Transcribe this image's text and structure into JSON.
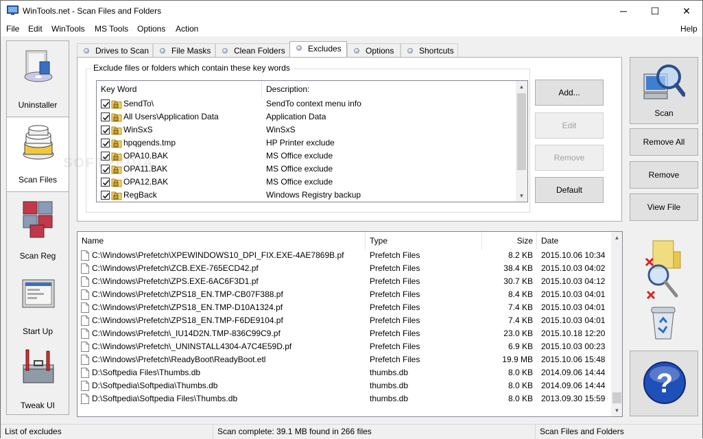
{
  "window": {
    "title": "WinTools.net - Scan Files and Folders",
    "minimize": "─",
    "maximize": "☐",
    "close": "✕"
  },
  "menu": {
    "file": "File",
    "edit": "Edit",
    "wintools": "WinTools",
    "mstools": "MS Tools",
    "options": "Options",
    "action": "Action",
    "help": "Help"
  },
  "sidebar": {
    "items": [
      {
        "label": "Uninstaller",
        "icon": "uninstaller-icon"
      },
      {
        "label": "Scan Files",
        "icon": "scan-files-icon",
        "active": true
      },
      {
        "label": "Scan Reg",
        "icon": "scan-reg-icon"
      },
      {
        "label": "Start Up",
        "icon": "startup-icon"
      },
      {
        "label": "Tweak UI",
        "icon": "tweak-ui-icon"
      }
    ]
  },
  "tabs": [
    {
      "label": "Drives to Scan"
    },
    {
      "label": "File Masks"
    },
    {
      "label": "Clean Folders"
    },
    {
      "label": "Excludes",
      "active": true
    },
    {
      "label": "Options"
    },
    {
      "label": "Shortcuts"
    }
  ],
  "excludes": {
    "group_title": "Exclude files or folders which contain these key words",
    "headers": {
      "keyword": "Key Word",
      "description": "Description:"
    },
    "rows": [
      {
        "keyword": "SendTo\\",
        "description": "SendTo context menu info",
        "checked": true
      },
      {
        "keyword": "All Users\\Application Data",
        "description": "Application Data",
        "checked": true
      },
      {
        "keyword": "WinSxS",
        "description": "WinSxS",
        "checked": true
      },
      {
        "keyword": "hpqgends.tmp",
        "description": "HP Printer exclude",
        "checked": true
      },
      {
        "keyword": "OPA10.BAK",
        "description": "MS Office exclude",
        "checked": true
      },
      {
        "keyword": "OPA11.BAK",
        "description": "MS Office exclude",
        "checked": true
      },
      {
        "keyword": "OPA12.BAK",
        "description": "MS Office exclude",
        "checked": true
      },
      {
        "keyword": "RegBack",
        "description": "Windows Registry backup",
        "checked": true
      }
    ],
    "buttons": {
      "add": "Add...",
      "edit": "Edit",
      "remove": "Remove",
      "default": "Default"
    }
  },
  "actions": {
    "scan": "Scan",
    "remove_all": "Remove All",
    "remove": "Remove",
    "view_file": "View File"
  },
  "files": {
    "headers": {
      "name": "Name",
      "type": "Type",
      "size": "Size",
      "date": "Date"
    },
    "rows": [
      {
        "name": "C:\\Windows\\Prefetch\\XPEWINDOWS10_DPI_FIX.EXE-4AE7869B.pf",
        "type": "Prefetch Files",
        "size": "8.2 KB",
        "date": "2015.10.06 10:34"
      },
      {
        "name": "C:\\Windows\\Prefetch\\ZCB.EXE-765ECD42.pf",
        "type": "Prefetch Files",
        "size": "38.4 KB",
        "date": "2015.10.03 04:02"
      },
      {
        "name": "C:\\Windows\\Prefetch\\ZPS.EXE-6AC6F3D1.pf",
        "type": "Prefetch Files",
        "size": "30.7 KB",
        "date": "2015.10.03 04:12"
      },
      {
        "name": "C:\\Windows\\Prefetch\\ZPS18_EN.TMP-CB07F388.pf",
        "type": "Prefetch Files",
        "size": "8.4 KB",
        "date": "2015.10.03 04:01"
      },
      {
        "name": "C:\\Windows\\Prefetch\\ZPS18_EN.TMP-D10A1324.pf",
        "type": "Prefetch Files",
        "size": "7.4 KB",
        "date": "2015.10.03 04:01"
      },
      {
        "name": "C:\\Windows\\Prefetch\\ZPS18_EN.TMP-F6DE9104.pf",
        "type": "Prefetch Files",
        "size": "7.4 KB",
        "date": "2015.10.03 04:01"
      },
      {
        "name": "C:\\Windows\\Prefetch\\_IU14D2N.TMP-836C99C9.pf",
        "type": "Prefetch Files",
        "size": "23.0 KB",
        "date": "2015.10.18 12:20"
      },
      {
        "name": "C:\\Windows\\Prefetch\\_UNINSTALL4304-A7C4E59D.pf",
        "type": "Prefetch Files",
        "size": "6.9 KB",
        "date": "2015.10.03 00:23"
      },
      {
        "name": "C:\\Windows\\Prefetch\\ReadyBoot\\ReadyBoot.etl",
        "type": "Prefetch Files",
        "size": "19.9 MB",
        "date": "2015.10.06 15:48"
      },
      {
        "name": "D:\\Softpedia Files\\Thumbs.db",
        "type": "thumbs.db",
        "size": "8.0 KB",
        "date": "2014.09.06 14:44"
      },
      {
        "name": "D:\\Softpedia\\Softpedia\\Thumbs.db",
        "type": "thumbs.db",
        "size": "8.0 KB",
        "date": "2014.09.06 14:44"
      },
      {
        "name": "D:\\Softpedia\\Softpedia Files\\Thumbs.db",
        "type": "thumbs.db",
        "size": "8.0 KB",
        "date": "2013.09.30 15:59"
      }
    ]
  },
  "status": {
    "left": "List of excludes",
    "middle": "Scan complete: 39.1 MB found in 266 files",
    "right": "Scan Files and Folders"
  },
  "watermark": "SOFTPEDIA"
}
